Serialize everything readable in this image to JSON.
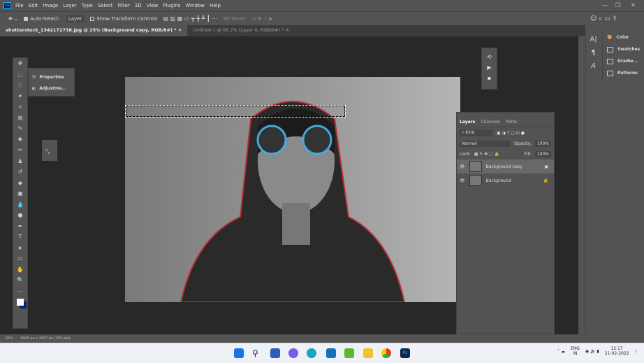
{
  "menu": {
    "items": [
      "File",
      "Edit",
      "Image",
      "Layer",
      "Type",
      "Select",
      "Filter",
      "3D",
      "View",
      "Plugins",
      "Window",
      "Help"
    ]
  },
  "options": {
    "auto_select": "Auto-Select:",
    "layer_select": "Layer",
    "show_transform": "Show Transform Controls",
    "mode_3d": "3D Mode:"
  },
  "tabs": [
    {
      "label": "shutterstock_1342172738.jpg @ 25% (Background copy, RGB/8#) *"
    },
    {
      "label": "Untitled-1 @ 66.7% (Layer 6, RGB/8#) *"
    }
  ],
  "props_panel": {
    "items": [
      "Properties",
      "Adjustme..."
    ]
  },
  "layers_panel": {
    "tabs": [
      "Layers",
      "Channels",
      "Paths"
    ],
    "filter": "Kind",
    "blend": "Normal",
    "opacity_label": "Opacity:",
    "opacity": "100%",
    "lock_label": "Lock:",
    "fill_label": "Fill:",
    "fill": "100%",
    "layers": [
      {
        "name": "Background copy",
        "selected": true
      },
      {
        "name": "Background",
        "selected": false,
        "locked": true
      }
    ]
  },
  "right_panel": {
    "items": [
      "Color",
      "Swatches",
      "Gradie...",
      "Patterns"
    ]
  },
  "status": {
    "doc_info": "4000 px x 2667 px (300 ppi)",
    "zoom": "25%"
  },
  "taskbar": {
    "lang": "ENG",
    "region": "IN",
    "time": "12:17",
    "date": "21-02-2022"
  }
}
